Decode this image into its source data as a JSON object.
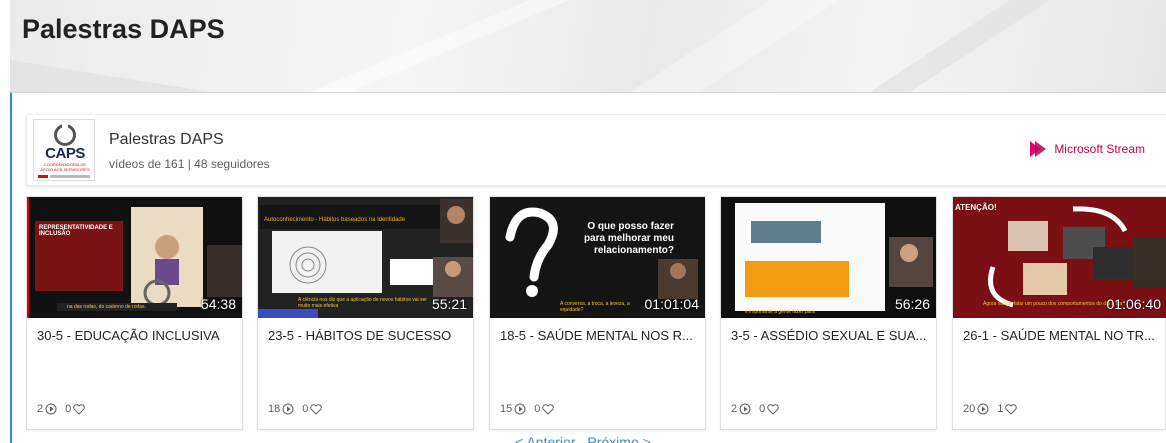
{
  "page": {
    "title": "Palestras DAPS"
  },
  "channel": {
    "name": "Palestras DAPS",
    "meta": "vídeos de 161 | 48 seguidores",
    "logo_text": "CAPS",
    "logo_sub": "COORDENADORIA DE APOIO AOS SERVIDORES",
    "brand": "Microsoft Stream",
    "accent_color": "#c30052"
  },
  "videos": [
    {
      "title": "30-5 - EDUCAÇÃO INCLUSIVA",
      "duration": "54:38",
      "views": "2",
      "likes": "0",
      "thumb_heading": "REPRESENTATIVIDADE E INCLUSÃO",
      "thumb_caption": "na das rodas, do caderno de rodas."
    },
    {
      "title": "23-5 - HÁBITOS DE SUCESSO",
      "duration": "55:21",
      "views": "18",
      "likes": "0",
      "thumb_heading": "Autoconhecimento - Hábitos baseados na Identidade",
      "thumb_caption": "A ciência nos diz que a aplicação de novos hábitos vai ser muito mais efetiva"
    },
    {
      "title": "18-5 - SAÚDE MENTAL NOS R...",
      "duration": "01:01:04",
      "views": "15",
      "likes": "0",
      "thumb_heading": "O que posso fazer para melhorar meu relacionamento?",
      "thumb_caption": "A conversa, a troca, a leveza, a equidade?"
    },
    {
      "title": "3-5 - ASSÉDIO SEXUAL E SUA...",
      "duration": "56:26",
      "views": "2",
      "likes": "0",
      "thumb_heading": "",
      "thumb_caption": "é importante a gente fazer para"
    },
    {
      "title": "26-1 - SAÚDE MENTAL NO TR...",
      "duration": "01:06:40",
      "views": "20",
      "likes": "1",
      "thumb_heading": "ATENÇÃO!",
      "thumb_caption": "Agora vamos falar um pouco dos comportamentos do dia a dia"
    }
  ],
  "pager": {
    "prev": "< Anterior",
    "next": "Próximo >"
  }
}
